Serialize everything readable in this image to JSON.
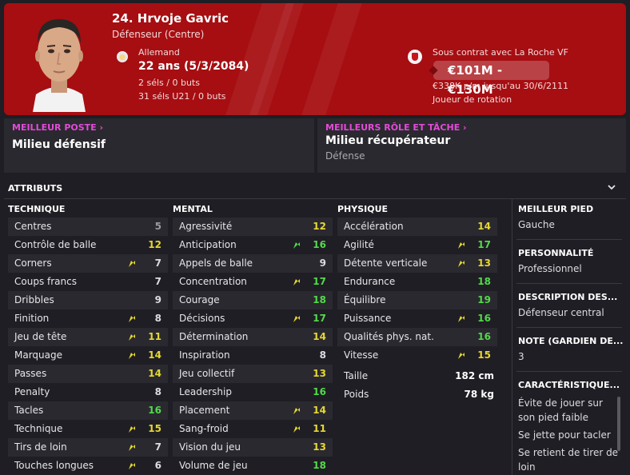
{
  "player": {
    "name": "24. Hrvoje Gavric",
    "position": "Défenseur (Centre)",
    "nationality": "Allemand",
    "age": "22 ans (5/3/2084)",
    "caps": "2 séls / 0 buts",
    "caps_u21": "31 séls U21 / 0 buts",
    "contract": "Sous contrat avec La Roche VF",
    "value": "€101M - €130M",
    "wage": "€338K p/m jusqu'au 30/6/2111",
    "squad_status": "Joueur de rotation"
  },
  "best_position": {
    "title": "MEILLEUR POSTE",
    "value": "Milieu défensif"
  },
  "best_role": {
    "title": "MEILLEURS RÔLE ET TÂCHE",
    "value": "Milieu récupérateur",
    "duty": "Défense"
  },
  "attributes_title": "ATTRIBUTS",
  "technique": {
    "title": "TECHNIQUE",
    "rows": [
      {
        "label": "Centres",
        "value": "5",
        "color": "grey",
        "trend": false
      },
      {
        "label": "Contrôle de balle",
        "value": "12",
        "color": "yellow",
        "trend": false
      },
      {
        "label": "Corners",
        "value": "7",
        "color": "white",
        "trend": true
      },
      {
        "label": "Coups francs",
        "value": "7",
        "color": "white",
        "trend": false
      },
      {
        "label": "Dribbles",
        "value": "9",
        "color": "white",
        "trend": false
      },
      {
        "label": "Finition",
        "value": "8",
        "color": "white",
        "trend": true
      },
      {
        "label": "Jeu de tête",
        "value": "11",
        "color": "yellow",
        "trend": true
      },
      {
        "label": "Marquage",
        "value": "14",
        "color": "yellow",
        "trend": true
      },
      {
        "label": "Passes",
        "value": "14",
        "color": "yellow",
        "trend": false
      },
      {
        "label": "Penalty",
        "value": "8",
        "color": "white",
        "trend": false
      },
      {
        "label": "Tacles",
        "value": "16",
        "color": "green",
        "trend": false
      },
      {
        "label": "Technique",
        "value": "15",
        "color": "yellow",
        "trend": true
      },
      {
        "label": "Tirs de loin",
        "value": "7",
        "color": "white",
        "trend": true
      },
      {
        "label": "Touches longues",
        "value": "6",
        "color": "white",
        "trend": true
      }
    ]
  },
  "mental": {
    "title": "MENTAL",
    "rows": [
      {
        "label": "Agressivité",
        "value": "12",
        "color": "yellow",
        "trend": false
      },
      {
        "label": "Anticipation",
        "value": "16",
        "color": "green",
        "trend": true,
        "trend_color": "green"
      },
      {
        "label": "Appels de balle",
        "value": "9",
        "color": "white",
        "trend": false
      },
      {
        "label": "Concentration",
        "value": "17",
        "color": "green",
        "trend": true
      },
      {
        "label": "Courage",
        "value": "18",
        "color": "green",
        "trend": false
      },
      {
        "label": "Décisions",
        "value": "17",
        "color": "green",
        "trend": true
      },
      {
        "label": "Détermination",
        "value": "14",
        "color": "yellow",
        "trend": false
      },
      {
        "label": "Inspiration",
        "value": "8",
        "color": "white",
        "trend": false
      },
      {
        "label": "Jeu collectif",
        "value": "13",
        "color": "yellow",
        "trend": false
      },
      {
        "label": "Leadership",
        "value": "16",
        "color": "green",
        "trend": false
      },
      {
        "label": "Placement",
        "value": "14",
        "color": "yellow",
        "trend": true
      },
      {
        "label": "Sang-froid",
        "value": "11",
        "color": "yellow",
        "trend": true
      },
      {
        "label": "Vision du jeu",
        "value": "13",
        "color": "yellow",
        "trend": false
      },
      {
        "label": "Volume de jeu",
        "value": "18",
        "color": "green",
        "trend": false
      }
    ]
  },
  "physique": {
    "title": "PHYSIQUE",
    "rows": [
      {
        "label": "Accélération",
        "value": "14",
        "color": "yellow",
        "trend": false
      },
      {
        "label": "Agilité",
        "value": "17",
        "color": "green",
        "trend": true
      },
      {
        "label": "Détente verticale",
        "value": "13",
        "color": "yellow",
        "trend": true
      },
      {
        "label": "Endurance",
        "value": "18",
        "color": "green",
        "trend": false
      },
      {
        "label": "Équilibre",
        "value": "19",
        "color": "green",
        "trend": false
      },
      {
        "label": "Puissance",
        "value": "16",
        "color": "green",
        "trend": true
      },
      {
        "label": "Qualités phys. nat.",
        "value": "16",
        "color": "green",
        "trend": false
      },
      {
        "label": "Vitesse",
        "value": "15",
        "color": "yellow",
        "trend": true
      }
    ],
    "height_label": "Taille",
    "height": "182 cm",
    "weight_label": "Poids",
    "weight": "78 kg"
  },
  "side": {
    "foot_title": "MEILLEUR PIED",
    "foot": "Gauche",
    "personality_title": "PERSONNALITÉ",
    "personality": "Professionnel",
    "description_title": "DESCRIPTION DES...",
    "description": "Défenseur central",
    "gk_title": "NOTE (GARDIEN DE...",
    "gk": "3",
    "traits_title": "CARACTÉRISTIQUE...",
    "traits": [
      "Évite de jouer sur son pied faible",
      "Se jette pour tacler",
      "Se retient de tirer de loin"
    ]
  },
  "colors": {
    "header_red": "#a60e12",
    "accent_pink": "#e34bd8",
    "attr_yellow": "#e5d734",
    "attr_green": "#52d94a"
  }
}
